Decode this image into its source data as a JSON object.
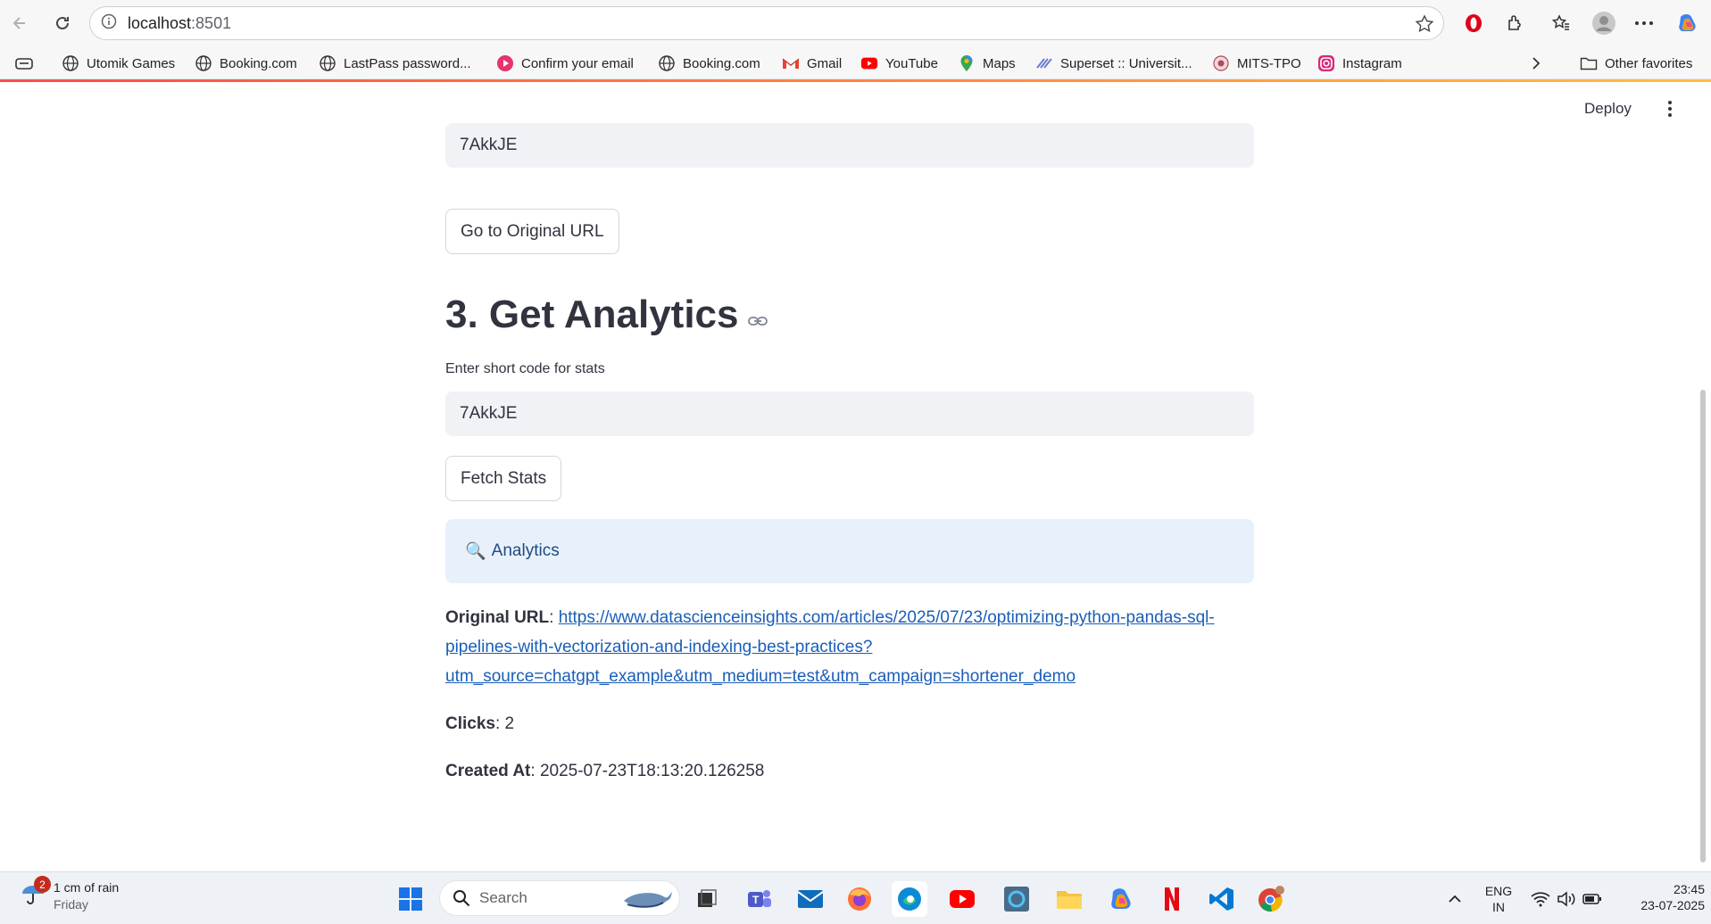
{
  "browser": {
    "url_host": "localhost",
    "url_port": ":8501",
    "bookmarks": [
      "Utomik Games",
      "Booking.com",
      "LastPass password...",
      "Confirm your email",
      "Booking.com",
      "Gmail",
      "YouTube",
      "Maps",
      "Superset :: Universit...",
      "MITS-TPO",
      "Instagram"
    ],
    "other_favorites": "Other favorites"
  },
  "app": {
    "deploy_label": "Deploy",
    "section2": {
      "short_code_value": "7AkkJE",
      "go_button": "Go to Original URL"
    },
    "section3": {
      "heading": "3. Get Analytics",
      "input_label": "Enter short code for stats",
      "input_value": "7AkkJE",
      "fetch_button": "Fetch Stats",
      "info_icon": "🔍",
      "info_text": "Analytics",
      "original_url_label": "Original URL",
      "original_url": "https://www.datascienceinsights.com/articles/2025/07/23/optimizing-python-pandas-sql-pipelines-with-vectorization-and-indexing-best-practices?utm_source=chatgpt_example&utm_medium=test&utm_campaign=shortener_demo",
      "original_url_lines": [
        "https://www.datascienceinsights.com/articles/2025/07/23/optimizing-python-pandas-sql-",
        "pipelines-with-vectorization-and-indexing-best-practices?",
        "utm_source=chatgpt_example&utm_medium=test&utm_campaign=shortener_demo"
      ],
      "clicks_label": "Clicks",
      "clicks_value": "2",
      "created_label": "Created At",
      "created_value": "2025-07-23T18:13:20.126258"
    }
  },
  "taskbar": {
    "weather_badge": "2",
    "weather_title": "1 cm of rain",
    "weather_day": "Friday",
    "search_placeholder": "Search",
    "lang_top": "ENG",
    "lang_bottom": "IN",
    "time": "23:45",
    "date": "23-07-2025"
  },
  "colors": {
    "link": "#1a5eb8",
    "info_bg": "#e8f1fb",
    "input_bg": "#f0f2f6",
    "accent": "#ff4b4b"
  }
}
